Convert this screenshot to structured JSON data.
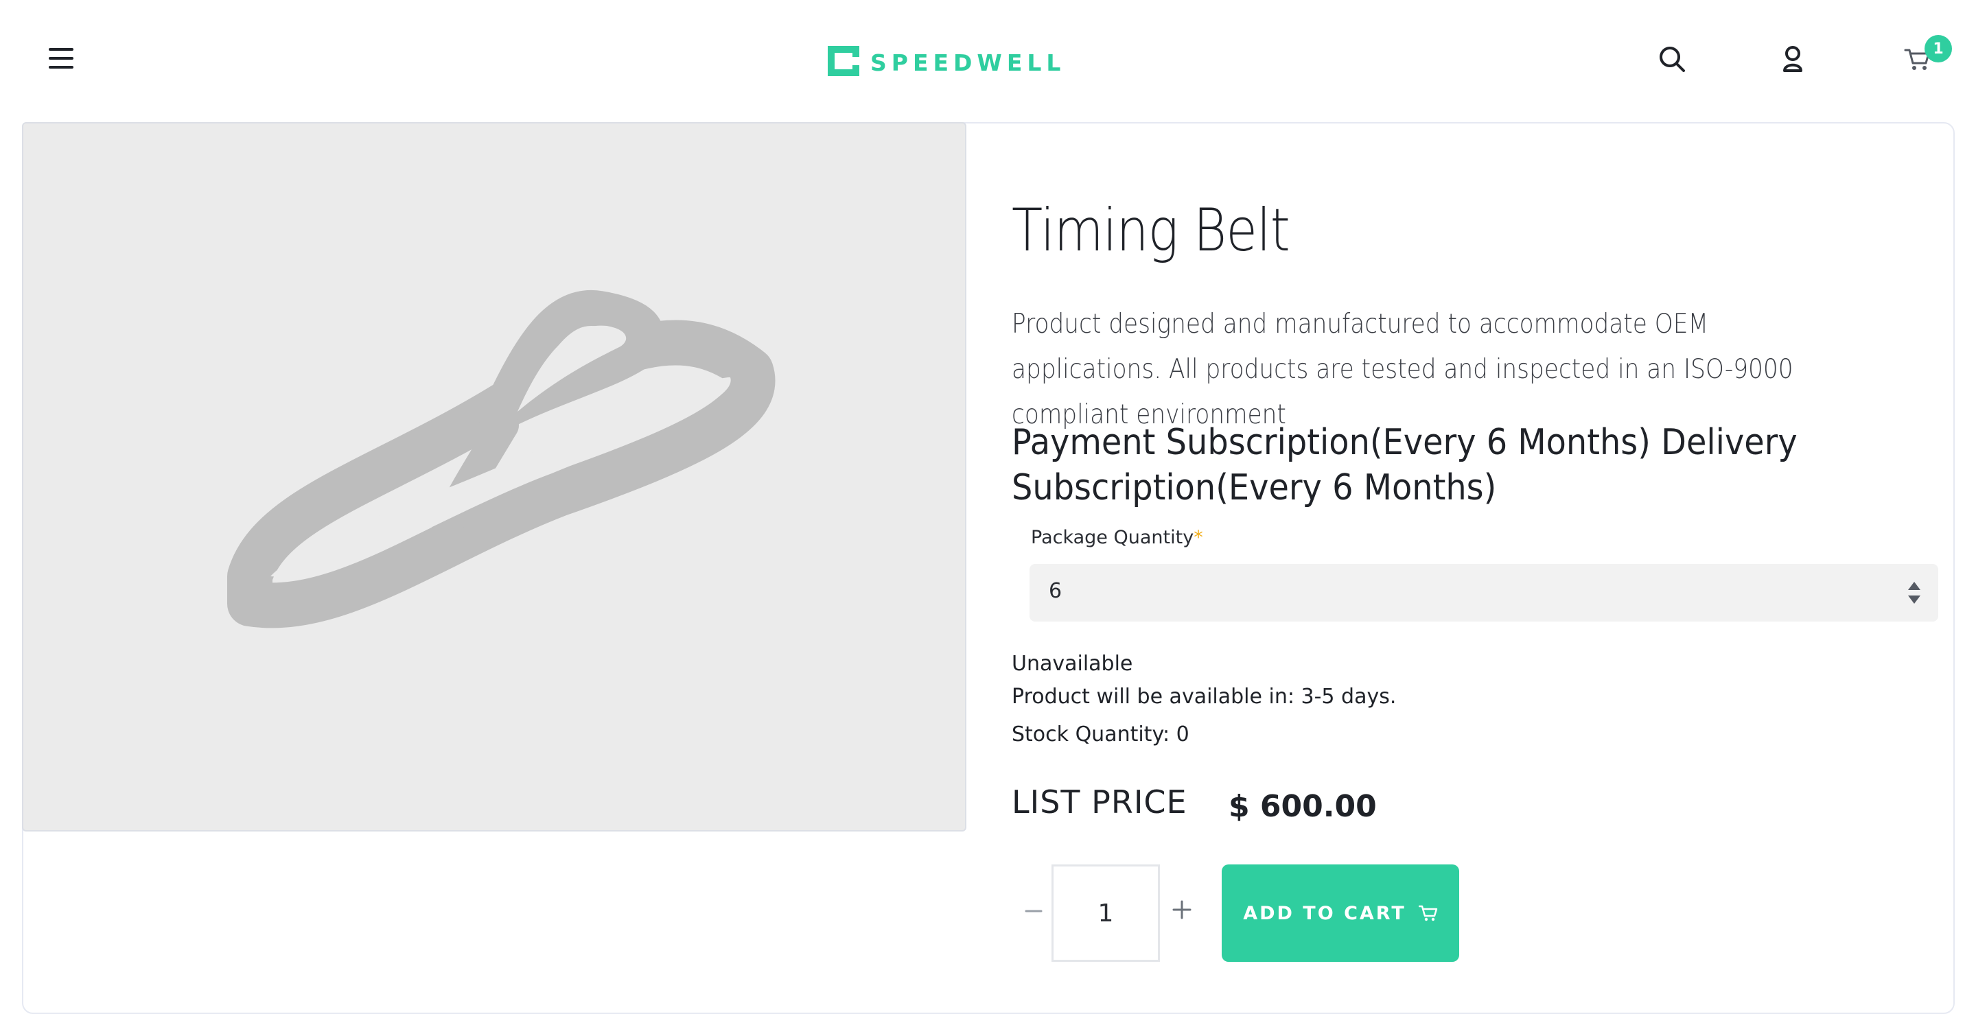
{
  "header": {
    "brand_name": "SPEEDWELL",
    "cart_count": "1"
  },
  "product": {
    "title": "Timing Belt",
    "description": "Product designed and manufactured to accommodate OEM applications. All products are tested and inspected in an ISO-9000 compliant environment",
    "subscription": "Payment Subscription(Every 6 Months) Delivery Subscription(Every 6 Months)",
    "package_quantity_label": "Package Quantity",
    "required_marker": "*",
    "package_quantity_value": "6",
    "availability": "Unavailable",
    "availability_eta": "Product will be available in: 3-5 days.",
    "stock_quantity": "Stock Quantity: 0",
    "list_price_label": "LIST PRICE",
    "price": "$ 600.00",
    "quantity": "1",
    "add_to_cart_label": "ADD TO CART"
  },
  "stepper": {
    "minus_symbol": "−",
    "plus_symbol": "+"
  },
  "colors": {
    "accent": "#2fce9f",
    "required": "#f2b01e",
    "image_bg": "#ebebeb",
    "belt": "#bdbdbd"
  },
  "icons": {
    "menu": "hamburger-icon",
    "search": "search-icon",
    "account": "user-icon",
    "cart": "cart-icon",
    "select": "sort-arrows-icon"
  }
}
